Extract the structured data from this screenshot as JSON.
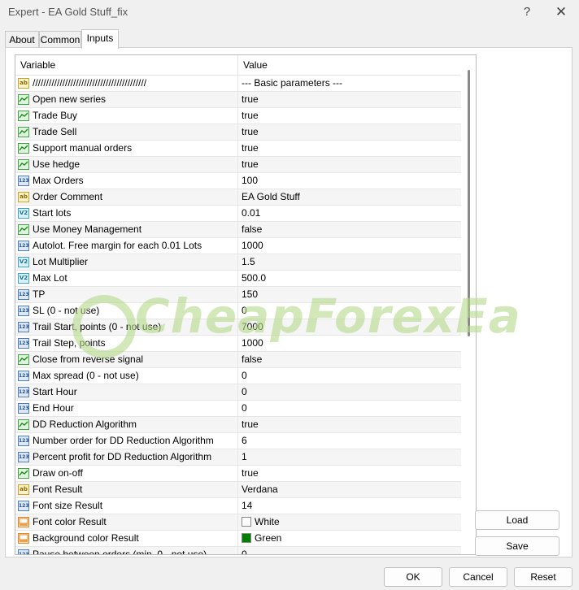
{
  "window": {
    "title": "Expert - EA Gold Stuff_fix",
    "help_glyph": "?",
    "close_glyph": "✕"
  },
  "tabs": [
    {
      "label": "About"
    },
    {
      "label": "Common"
    },
    {
      "label": "Inputs"
    }
  ],
  "active_tab": "Inputs",
  "table": {
    "col_variable": "Variable",
    "col_value": "Value"
  },
  "rows": [
    {
      "type": "str",
      "name": "//////////////////////////////////////////",
      "value": "--- Basic parameters ---"
    },
    {
      "type": "bool",
      "name": "Open new series",
      "value": "true"
    },
    {
      "type": "bool",
      "name": "Trade Buy",
      "value": "true"
    },
    {
      "type": "bool",
      "name": "Trade Sell",
      "value": "true"
    },
    {
      "type": "bool",
      "name": "Support manual orders",
      "value": "true"
    },
    {
      "type": "bool",
      "name": "Use hedge",
      "value": "true"
    },
    {
      "type": "int",
      "name": "Max Orders",
      "value": "100"
    },
    {
      "type": "str",
      "name": "Order Comment",
      "value": "EA Gold Stuff"
    },
    {
      "type": "dbl",
      "name": "Start lots",
      "value": "0.01"
    },
    {
      "type": "bool",
      "name": "Use Money Management",
      "value": "false"
    },
    {
      "type": "int",
      "name": "Autolot. Free margin for each 0.01 Lots",
      "value": "1000"
    },
    {
      "type": "dbl",
      "name": "Lot Multiplier",
      "value": "1.5"
    },
    {
      "type": "dbl",
      "name": "Max Lot",
      "value": "500.0"
    },
    {
      "type": "int",
      "name": "TP",
      "value": "150"
    },
    {
      "type": "int",
      "name": "SL (0 - not use)",
      "value": "0"
    },
    {
      "type": "int",
      "name": "Trail Start, points (0 - not use)",
      "value": "7000"
    },
    {
      "type": "int",
      "name": "Trail Step, points",
      "value": "1000"
    },
    {
      "type": "bool",
      "name": "Close from reverse signal",
      "value": "false"
    },
    {
      "type": "int",
      "name": "Max spread (0 - not use)",
      "value": "0"
    },
    {
      "type": "int",
      "name": "Start Hour",
      "value": "0"
    },
    {
      "type": "int",
      "name": "End Hour",
      "value": "0"
    },
    {
      "type": "bool",
      "name": "DD Reduction Algorithm",
      "value": "true"
    },
    {
      "type": "int",
      "name": "Number order for DD Reduction Algorithm",
      "value": "6"
    },
    {
      "type": "int",
      "name": "Percent profit for DD Reduction Algorithm",
      "value": "1"
    },
    {
      "type": "bool",
      "name": "Draw on-off",
      "value": "true"
    },
    {
      "type": "str",
      "name": "Font Result",
      "value": "Verdana"
    },
    {
      "type": "int",
      "name": "Font size Result",
      "value": "14"
    },
    {
      "type": "col",
      "name": "Font color Result",
      "value": "White",
      "swatch": "#ffffff"
    },
    {
      "type": "col",
      "name": "Background color Result",
      "value": "Green",
      "swatch": "#008000"
    },
    {
      "type": "int",
      "name": "Pause between orders (min. 0 - not use)",
      "value": "0"
    }
  ],
  "icon_labels": {
    "bool": "",
    "int": "123",
    "dbl": "V2",
    "str": "ab",
    "col": ""
  },
  "side_buttons": {
    "load": "Load",
    "save": "Save"
  },
  "footer": {
    "ok": "OK",
    "cancel": "Cancel",
    "reset": "Reset"
  },
  "watermark": {
    "text": "CheapForexEa"
  }
}
